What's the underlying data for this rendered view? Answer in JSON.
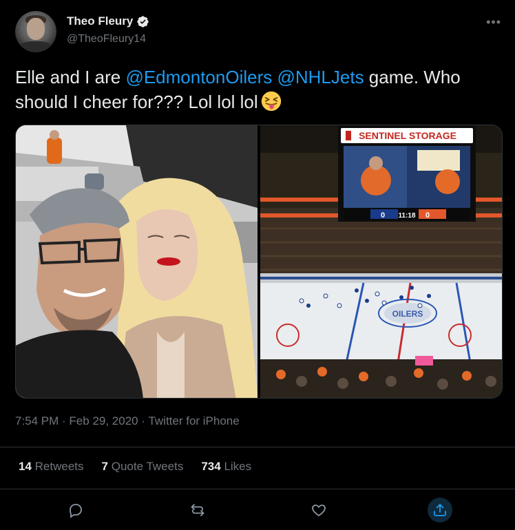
{
  "author": {
    "display_name": "Theo Fleury",
    "handle": "@TheoFleury14",
    "verified": true
  },
  "tweet": {
    "text_parts": [
      "Elle and I are ",
      "@EdmontonOilers",
      " ",
      "@NHLJets",
      " game. Who should I cheer for??? Lol lol lol"
    ],
    "emoji": "squinting-face-with-tongue"
  },
  "media": {
    "left_photo": {
      "description_icon": "selfie-photo"
    },
    "right_photo": {
      "scoreboard_brand": "SENTINEL STORAGE",
      "clock": "11:18",
      "home_score": "0",
      "away_score": "0",
      "ribbon_text": "SENTINEL STORAGE",
      "logo_text": "OILERS"
    }
  },
  "meta": {
    "time": "7:54 PM",
    "date": "Feb 29, 2020",
    "source": "Twitter for iPhone",
    "separator": " · "
  },
  "stats": {
    "retweets_count": "14",
    "retweets_label": "Retweets",
    "quotes_count": "7",
    "quotes_label": "Quote Tweets",
    "likes_count": "734",
    "likes_label": "Likes"
  },
  "colors": {
    "background": "#000000",
    "text": "#e7e9ea",
    "muted": "#71767b",
    "link": "#1d9bf0",
    "border": "#2f3336"
  }
}
